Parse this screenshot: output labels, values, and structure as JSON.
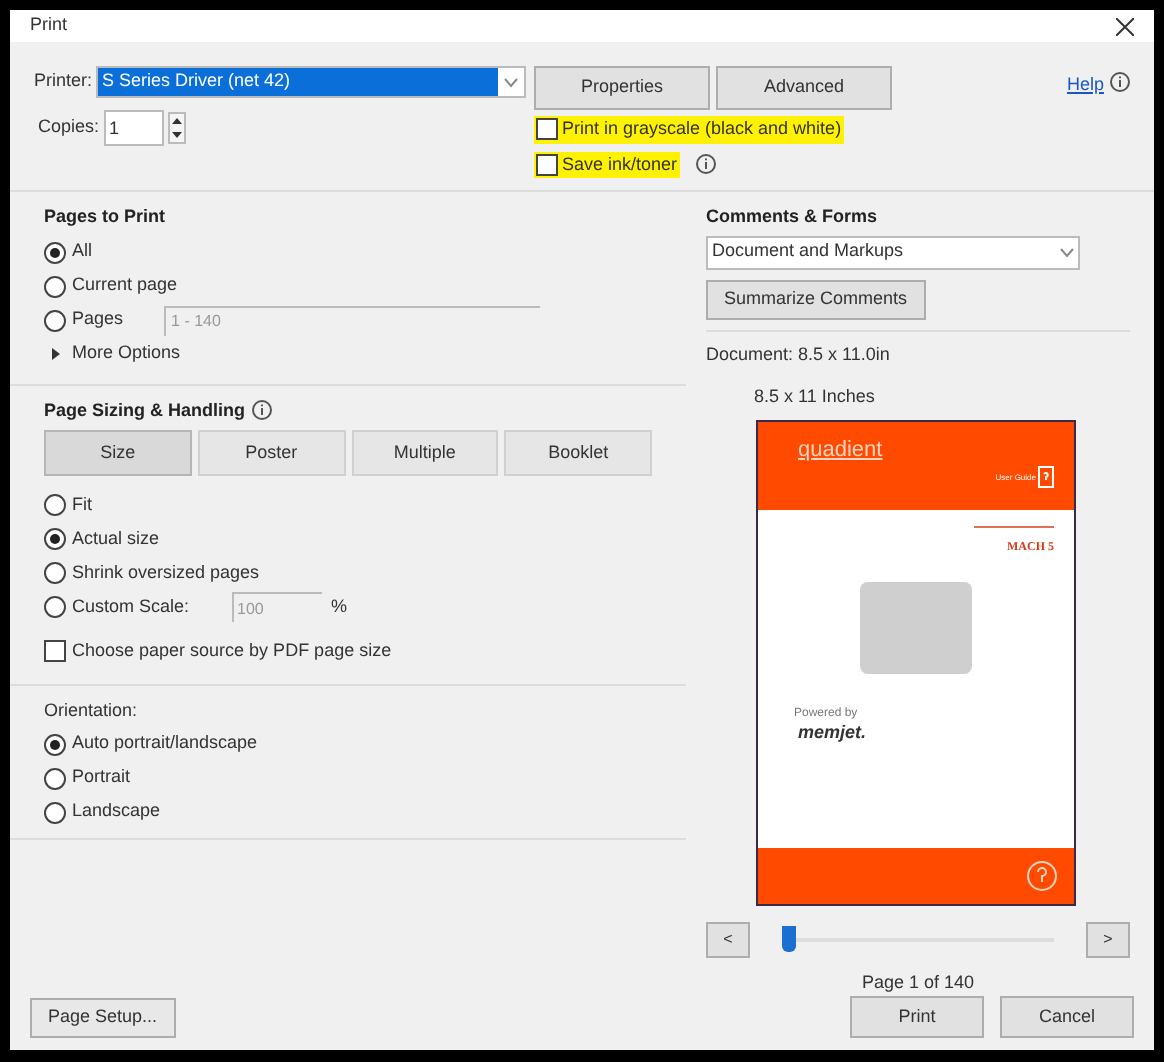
{
  "window": {
    "title": "Print"
  },
  "printer": {
    "label": "Printer:",
    "value": "S Series Driver (net 42)",
    "buttons": [
      "Properties",
      "Advanced"
    ]
  },
  "help": {
    "label": "Help"
  },
  "copies": {
    "label": "Copies:",
    "value": "1"
  },
  "options": [
    {
      "label": "Print in grayscale (black and white)",
      "checked": false,
      "highlighted": true,
      "info": false
    },
    {
      "label": "Save ink/toner",
      "checked": false,
      "highlighted": true,
      "info": true
    }
  ],
  "pages_to_print": {
    "title": "Pages to Print",
    "radios": [
      {
        "label": "All",
        "selected": true
      },
      {
        "label": "Current page",
        "selected": false
      },
      {
        "label": "Pages",
        "selected": false,
        "placeholder": "1 - 140"
      }
    ],
    "more_options": "More Options"
  },
  "page_sizing": {
    "title": "Page Sizing & Handling",
    "tabs": [
      {
        "label": "Size",
        "selected": true
      },
      {
        "label": "Poster",
        "selected": false
      },
      {
        "label": "Multiple",
        "selected": false
      },
      {
        "label": "Booklet",
        "selected": false
      }
    ],
    "radios": [
      {
        "label": "Fit",
        "selected": false
      },
      {
        "label": "Actual size",
        "selected": true
      },
      {
        "label": "Shrink oversized pages",
        "selected": false
      },
      {
        "label": "Custom Scale:",
        "selected": false,
        "placeholder": "100",
        "unit": "%"
      }
    ],
    "paper_source": {
      "label": "Choose paper source by PDF page size",
      "checked": false
    }
  },
  "orientation": {
    "title": "Orientation:",
    "radios": [
      {
        "label": "Auto portrait/landscape",
        "selected": true
      },
      {
        "label": "Portrait",
        "selected": false
      },
      {
        "label": "Landscape",
        "selected": false
      }
    ]
  },
  "comments_forms": {
    "title": "Comments & Forms",
    "value": "Document and Markups",
    "button": "Summarize Comments"
  },
  "document": {
    "size": "Document: 8.5 x 11.0in",
    "preview_size": "8.5 x 11 Inches",
    "preview": {
      "brand": "quadient",
      "guide": "User Guide",
      "product": "MACH 5",
      "powered": "Powered by",
      "partner": "memjet."
    }
  },
  "navigation": {
    "prev": "<",
    "next": ">",
    "level": 0,
    "page": "Page 1 of 140"
  },
  "footer": {
    "page_setup": "Page Setup...",
    "print": "Print",
    "cancel": "Cancel"
  }
}
